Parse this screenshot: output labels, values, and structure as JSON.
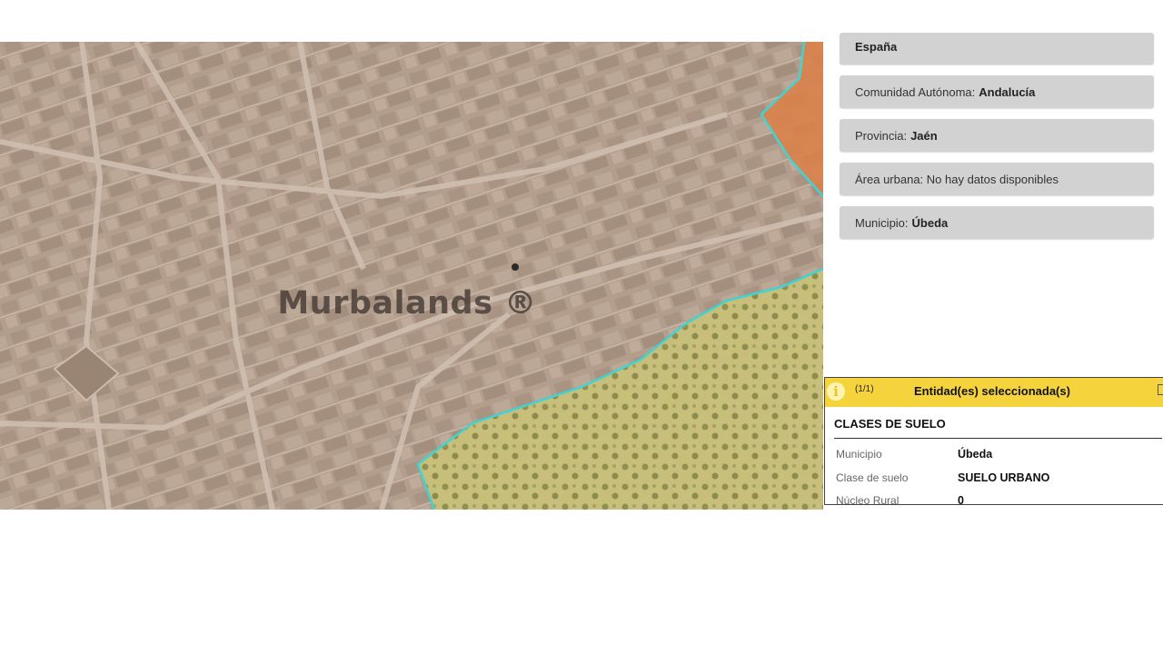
{
  "map": {
    "watermark": "Murbalands ®",
    "colors": {
      "urban": "#b6a08f",
      "rural_yellow": "#c9c376",
      "orange_zone": "#d9824a",
      "boundary": "#3fd4d4"
    }
  },
  "info_cards": [
    {
      "key": "",
      "value": "España"
    },
    {
      "key": "Comunidad Autónoma:",
      "value": "Andalucía"
    },
    {
      "key": "Provincia:",
      "value": "Jaén"
    },
    {
      "key": "Área urbana: No hay datos disponibles",
      "value": ""
    },
    {
      "key": "Municipio:",
      "value": "Úbeda"
    }
  ],
  "popup": {
    "counter": "(1/1)",
    "title": "Entidad(es) seleccionada(s)",
    "section_title": "CLASES DE SUELO",
    "rows": [
      {
        "key": "Municipio",
        "value": "Úbeda"
      },
      {
        "key": "Clase de suelo",
        "value": "SUELO URBANO"
      },
      {
        "key": "Núcleo Rural",
        "value": "0"
      }
    ],
    "icons": {
      "info": "info-icon",
      "maximize": "maximize-icon"
    }
  }
}
